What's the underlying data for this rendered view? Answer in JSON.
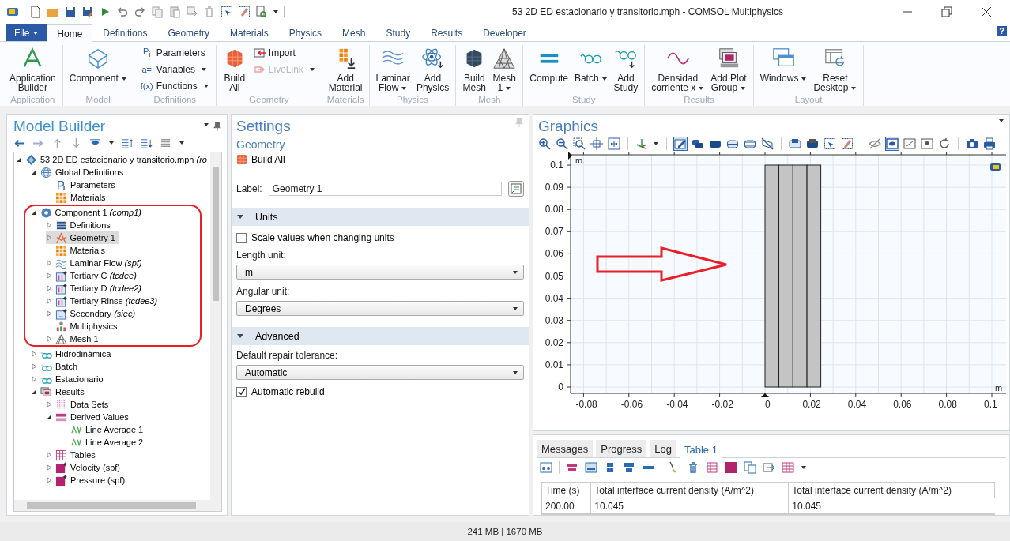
{
  "window": {
    "title": "53 2D ED estacionario y transitorio.mph - COMSOL Multiphysics"
  },
  "ribbon": {
    "file_button": "File",
    "tabs": [
      {
        "label": "Home",
        "selected": true
      },
      {
        "label": "Definitions",
        "selected": false
      },
      {
        "label": "Geometry",
        "selected": false
      },
      {
        "label": "Materials",
        "selected": false
      },
      {
        "label": "Physics",
        "selected": false
      },
      {
        "label": "Mesh",
        "selected": false
      },
      {
        "label": "Study",
        "selected": false
      },
      {
        "label": "Results",
        "selected": false
      },
      {
        "label": "Developer",
        "selected": false
      }
    ],
    "help": "?",
    "groups": [
      {
        "name": "Application",
        "buttons": [
          {
            "kind": "large",
            "label": "Application\nBuilder",
            "menu": false,
            "disabled": false
          }
        ]
      },
      {
        "name": "Model",
        "buttons": [
          {
            "kind": "large",
            "label": "Component",
            "menu": true,
            "disabled": false
          }
        ]
      },
      {
        "name": "Definitions",
        "buttons": [
          {
            "kind": "small",
            "glyph": "P$_{i}$",
            "label": "Parameters",
            "menu": false,
            "disabled": false
          },
          {
            "kind": "small",
            "glyph": "a=",
            "label": "Variables",
            "menu": true,
            "disabled": false
          },
          {
            "kind": "small",
            "glyph": "f(x)",
            "label": "Functions",
            "menu": true,
            "disabled": false
          }
        ]
      },
      {
        "name": "Geometry",
        "buttons": [
          {
            "kind": "large",
            "label": "Build\nAll",
            "menu": false,
            "disabled": false
          },
          {
            "kind": "small",
            "label": "Import",
            "menu": false,
            "disabled": false
          },
          {
            "kind": "small",
            "label": "LiveLink",
            "menu": true,
            "disabled": true
          }
        ]
      },
      {
        "name": "Materials",
        "buttons": [
          {
            "kind": "large",
            "label": "Add\nMaterial",
            "menu": false,
            "disabled": false
          }
        ]
      },
      {
        "name": "Physics",
        "buttons": [
          {
            "kind": "large",
            "label": "Laminar\nFlow",
            "menu": true,
            "disabled": false
          },
          {
            "kind": "large",
            "label": "Add\nPhysics",
            "menu": false,
            "disabled": false
          }
        ]
      },
      {
        "name": "Mesh",
        "buttons": [
          {
            "kind": "large",
            "label": "Build\nMesh",
            "menu": false,
            "disabled": false
          },
          {
            "kind": "large",
            "label": "Mesh\n1",
            "menu": true,
            "disabled": false
          }
        ]
      },
      {
        "name": "Study",
        "buttons": [
          {
            "kind": "large",
            "label": "Compute",
            "menu": false,
            "disabled": false
          },
          {
            "kind": "large",
            "label": "Batch",
            "menu": true,
            "disabled": false
          },
          {
            "kind": "large",
            "label": "Add\nStudy",
            "menu": false,
            "disabled": false
          }
        ]
      },
      {
        "name": "Results",
        "buttons": [
          {
            "kind": "large",
            "label": "Densidad\ncorriente x",
            "menu": true,
            "disabled": false
          },
          {
            "kind": "large",
            "label": "Add Plot\nGroup",
            "menu": true,
            "disabled": false
          }
        ]
      },
      {
        "name": "Layout",
        "buttons": [
          {
            "kind": "large",
            "label": "Windows",
            "menu": true,
            "disabled": false
          },
          {
            "kind": "large",
            "label": "Reset\nDesktop",
            "menu": true,
            "disabled": false
          }
        ]
      }
    ]
  },
  "model_builder": {
    "title": "Model Builder",
    "tree": [
      {
        "label": "53 2D ED estacionario y transitorio.mph",
        "note": "(ro",
        "expanded": true,
        "selected": false,
        "children": [
          {
            "label": "Global Definitions",
            "expanded": true,
            "selected": false,
            "children": [
              {
                "label": "Parameters",
                "selected": false
              },
              {
                "label": "Materials",
                "selected": false
              }
            ]
          },
          {
            "label": "Component 1",
            "note": "(comp1)",
            "expanded": true,
            "selected": false,
            "children": [
              {
                "label": "Definitions",
                "expanded": false,
                "selected": false
              },
              {
                "label": "Geometry 1",
                "expanded": false,
                "selected": true
              },
              {
                "label": "Materials",
                "selected": false
              },
              {
                "label": "Laminar Flow",
                "note": "(spf)",
                "expanded": false,
                "selected": false
              },
              {
                "label": "Tertiary C",
                "note": "(tcdee)",
                "expanded": false,
                "selected": false
              },
              {
                "label": "Tertiary D",
                "note": "(tcdee2)",
                "expanded": false,
                "selected": false
              },
              {
                "label": "Tertiary Rinse",
                "note": "(tcdee3)",
                "expanded": false,
                "selected": false
              },
              {
                "label": "Secondary",
                "note": "(siec)",
                "expanded": false,
                "selected": false
              },
              {
                "label": "Multiphysics",
                "selected": false
              },
              {
                "label": "Mesh 1",
                "expanded": false,
                "selected": false
              }
            ]
          },
          {
            "label": "Hidrodinámica",
            "expanded": false,
            "selected": false
          },
          {
            "label": "Batch",
            "expanded": false,
            "selected": false
          },
          {
            "label": "Estacionario",
            "expanded": false,
            "selected": false
          },
          {
            "label": "Results",
            "expanded": true,
            "selected": false,
            "children": [
              {
                "label": "Data Sets",
                "expanded": false,
                "selected": false
              },
              {
                "label": "Derived Values",
                "expanded": true,
                "selected": false,
                "children": [
                  {
                    "label": "Line Average 1",
                    "selected": false
                  },
                  {
                    "label": "Line Average 2",
                    "selected": false
                  }
                ]
              },
              {
                "label": "Tables",
                "expanded": false,
                "selected": false
              },
              {
                "label": "Velocity (spf)",
                "expanded": false,
                "selected": false
              },
              {
                "label": "Pressure (spf)",
                "expanded": false,
                "selected": false
              }
            ]
          }
        ]
      }
    ]
  },
  "settings": {
    "title": "Settings",
    "subtitle": "Geometry",
    "action": "Build All",
    "label_field": {
      "label": "Label:",
      "value": "Geometry 1"
    },
    "sections": [
      {
        "title": "Units",
        "expanded": true,
        "items": [
          {
            "kind": "checkbox",
            "label": "Scale values when changing units",
            "checked": false
          },
          {
            "kind": "select",
            "label": "Length unit:",
            "value": "m"
          },
          {
            "kind": "select",
            "label": "Angular unit:",
            "value": "Degrees"
          }
        ]
      },
      {
        "title": "Advanced",
        "expanded": true,
        "items": [
          {
            "kind": "select",
            "label": "Default repair tolerance:",
            "value": "Automatic"
          },
          {
            "kind": "checkbox",
            "label": "Automatic rebuild",
            "checked": true
          }
        ]
      }
    ]
  },
  "graphics": {
    "title": "Graphics",
    "x_unit": "m",
    "y_unit": "m",
    "x_tick_labels": [
      "-0.08",
      "-0.06",
      "-0.04",
      "-0.02",
      "0",
      "0.02",
      "0.04",
      "0.06",
      "0.08",
      "0.1"
    ],
    "y_tick_labels": [
      "0.1",
      "0.09",
      "0.08",
      "0.07",
      "0.06",
      "0.05",
      "0.04",
      "0.03",
      "0.02",
      "0.01",
      "0"
    ]
  },
  "output": {
    "tabs": [
      {
        "label": "Messages",
        "selected": false
      },
      {
        "label": "Progress",
        "selected": false
      },
      {
        "label": "Log",
        "selected": false
      },
      {
        "label": "Table 1",
        "selected": true
      }
    ],
    "table": {
      "columns": [
        "Time (s)",
        "Total interface current density (A/m^2)",
        "Total interface current density (A/m^2)"
      ],
      "rows": [
        [
          "200.00",
          "10.045",
          "10.045"
        ]
      ]
    }
  },
  "status_bar": {
    "memory": "241 MB | 1670 MB"
  }
}
